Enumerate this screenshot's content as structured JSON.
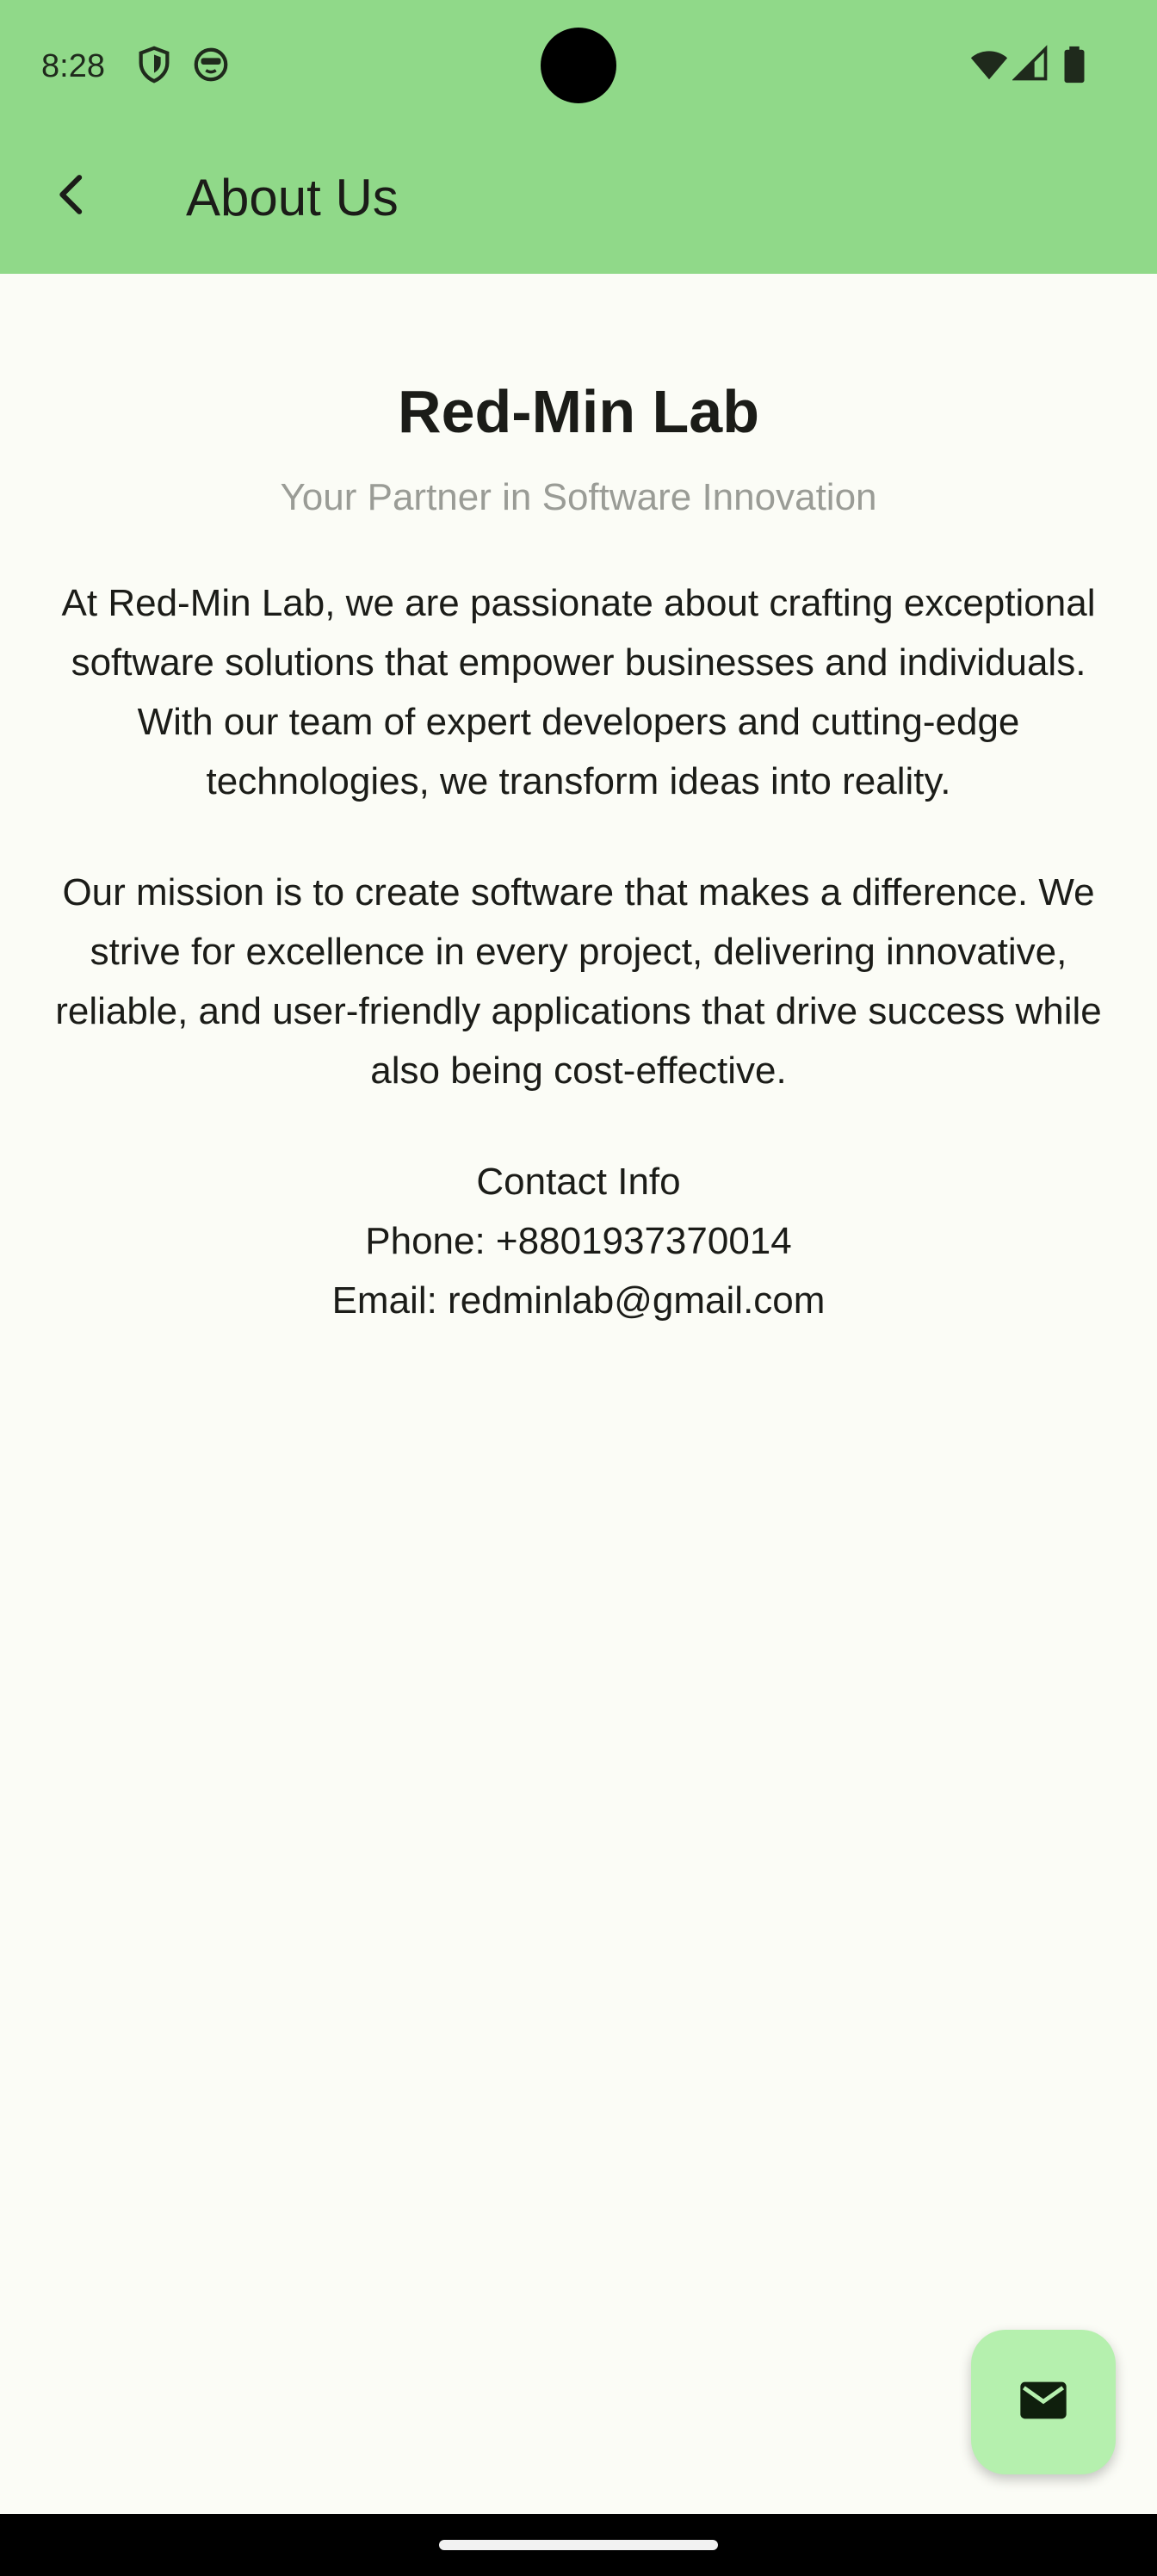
{
  "status_bar": {
    "time": "8:28",
    "left_icons": [
      "shield-icon",
      "face-icon"
    ],
    "right_icons": [
      "wifi-icon",
      "signal-icon",
      "battery-icon"
    ]
  },
  "app_bar": {
    "title": "About Us",
    "back_icon": "arrow-back-icon"
  },
  "about": {
    "heading": "Red-Min Lab",
    "tagline": "Your Partner in Software Innovation",
    "paragraphs": [
      "At Red-Min Lab, we are passionate about crafting exceptional software solutions that empower businesses and individuals. With our team of expert developers and cutting-edge technologies, we transform ideas into reality.",
      "Our mission is to create software that makes a difference. We strive for excellence in every project, delivering innovative, reliable, and user-friendly applications that drive success while also being cost-effective."
    ],
    "contact": {
      "title": "Contact Info",
      "phone": "Phone: +8801937370014",
      "email": "Email: redminlab@gmail.com"
    }
  },
  "fab": {
    "icon": "mail-icon"
  },
  "colors": {
    "app_bar": "#90d989",
    "background": "#fbfcf6",
    "fab": "#b5f0ae",
    "tagline": "#9a9c96"
  }
}
